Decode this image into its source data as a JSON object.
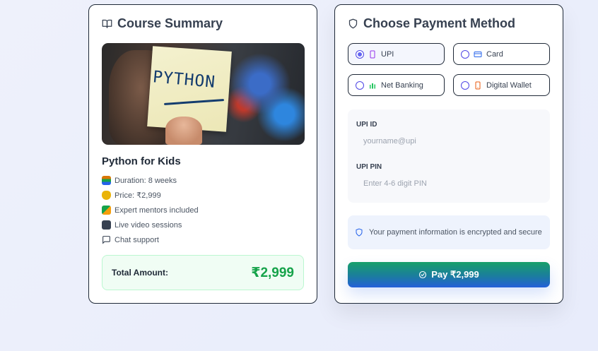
{
  "summary": {
    "title": "Course Summary",
    "title_icon": "book-open-icon",
    "image_text": "PYTHON",
    "course_name": "Python for Kids",
    "features": [
      {
        "icon": "books-icon",
        "text": "Duration: 8 weeks"
      },
      {
        "icon": "money-bag-icon",
        "text": "Price: ₹2,999"
      },
      {
        "icon": "teacher-icon",
        "text": "Expert mentors included"
      },
      {
        "icon": "tv-icon",
        "text": "Live video sessions"
      },
      {
        "icon": "chat-icon",
        "text": "Chat support"
      }
    ],
    "total_label": "Total Amount:",
    "total_amount": "₹2,999"
  },
  "payment": {
    "title": "Choose Payment Method",
    "title_icon": "shield-icon",
    "methods": [
      {
        "label": "UPI",
        "icon": "phone-icon",
        "selected": true
      },
      {
        "label": "Card",
        "icon": "credit-card-icon",
        "selected": false
      },
      {
        "label": "Net Banking",
        "icon": "bank-icon",
        "selected": false
      },
      {
        "label": "Digital Wallet",
        "icon": "mobile-wallet-icon",
        "selected": false
      }
    ],
    "upi_id_label": "UPI ID",
    "upi_id_placeholder": "yourname@upi",
    "upi_pin_label": "UPI PIN",
    "upi_pin_placeholder": "Enter 4-6 digit PIN",
    "secure_note": "Your payment information is encrypted and secure",
    "pay_button": "Pay ₹2,999"
  },
  "colors": {
    "accent_green": "#16a34a",
    "accent_blue": "#2563eb",
    "radio_accent": "#6366f1"
  }
}
